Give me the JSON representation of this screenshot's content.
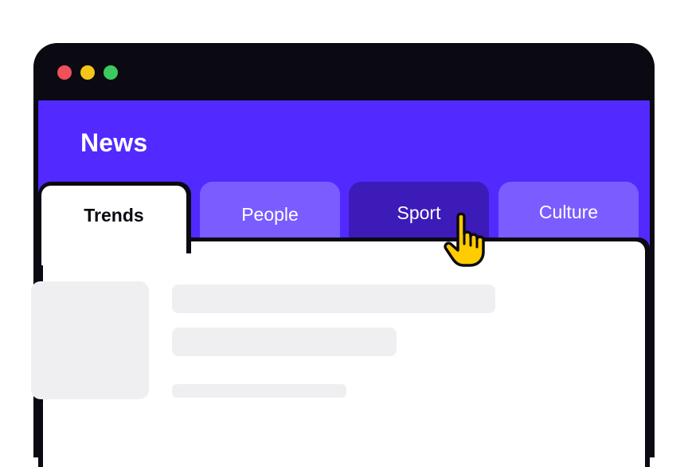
{
  "app": {
    "title": "News"
  },
  "tabs": [
    {
      "label": "Trends",
      "state": "active"
    },
    {
      "label": "People",
      "state": "inactive"
    },
    {
      "label": "Sport",
      "state": "hover"
    },
    {
      "label": "Culture",
      "state": "inactive"
    }
  ],
  "colors": {
    "brand": "#5229ff",
    "tab_inactive": "#7b5cff",
    "tab_hover": "#3d1bb8",
    "frame": "#0b0a12",
    "placeholder": "#efeff2",
    "cursor": "#ffcc00"
  },
  "icons": {
    "window_controls": [
      "close-dot",
      "minimize-dot",
      "maximize-dot"
    ],
    "pointer": "hand-pointer-icon"
  }
}
